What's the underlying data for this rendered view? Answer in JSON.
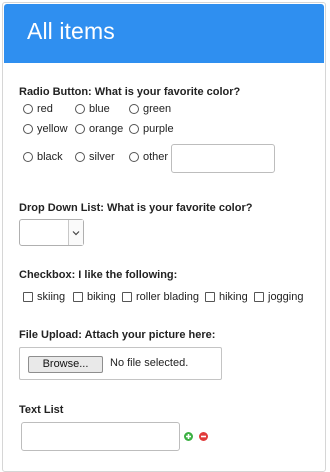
{
  "header": {
    "title": "All items"
  },
  "radio": {
    "label": "Radio Button: What is your favorite color?",
    "options": [
      "red",
      "blue",
      "green",
      "yellow",
      "orange",
      "purple",
      "black",
      "silver",
      "other"
    ],
    "other_value": ""
  },
  "dropdown": {
    "label": "Drop Down List: What is your favorite color?",
    "selected": ""
  },
  "checkbox": {
    "label": "Checkbox: I like the following:",
    "options": [
      "skiing",
      "biking",
      "roller blading",
      "hiking",
      "jogging"
    ]
  },
  "upload": {
    "label": "File Upload: Attach your picture here:",
    "browse_label": "Browse...",
    "status": "No file selected."
  },
  "textlist": {
    "label": "Text List",
    "value": "",
    "add_icon": "plus-circle-icon",
    "remove_icon": "minus-circle-icon"
  },
  "colors": {
    "header": "#2f8ff0",
    "add": "#3cb043",
    "remove": "#e03a3a"
  }
}
